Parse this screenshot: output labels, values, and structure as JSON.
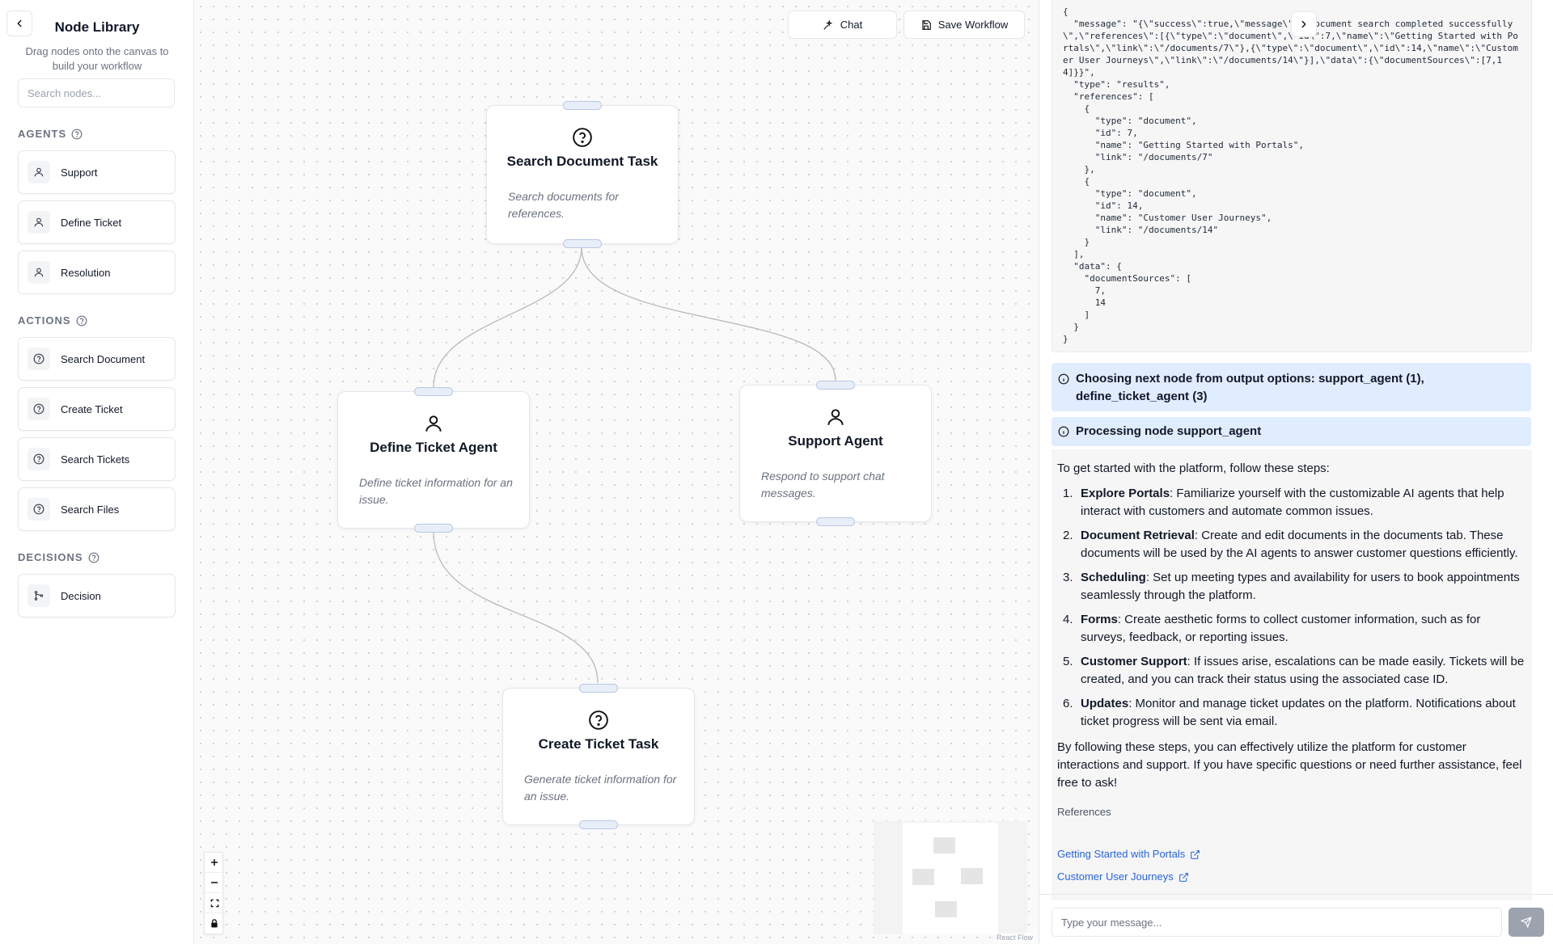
{
  "sidebar": {
    "title": "Node Library",
    "subtitle": "Drag nodes onto the canvas to build your workflow",
    "search_placeholder": "Search nodes...",
    "sections": {
      "agents": {
        "title": "AGENTS",
        "items": [
          "Support",
          "Define Ticket",
          "Resolution"
        ]
      },
      "actions": {
        "title": "ACTIONS",
        "items": [
          "Search Document",
          "Create Ticket",
          "Search Tickets",
          "Search Files"
        ]
      },
      "decisions": {
        "title": "DECISIONS",
        "items": [
          "Decision"
        ]
      }
    }
  },
  "toolbar": {
    "chat_label": "Chat",
    "save_label": "Save Workflow"
  },
  "canvas": {
    "nodes": {
      "search_document": {
        "title": "Search Document Task",
        "description": "Search documents for references."
      },
      "define_ticket": {
        "title": "Define Ticket Agent",
        "description": "Define ticket information for an issue."
      },
      "support": {
        "title": "Support Agent",
        "description": "Respond to support chat messages."
      },
      "create_ticket": {
        "title": "Create Ticket Task",
        "description": "Generate ticket information for an issue."
      }
    },
    "attribution": "React Flow"
  },
  "chat": {
    "code_output": "{\n  \"message\": \"{\\\"success\\\":true,\\\"message\\\":\\\"Document search completed successfully\\\",\\\"references\\\":[{\\\"type\\\":\\\"document\\\",\\\"id\\\":7,\\\"name\\\":\\\"Getting Started with Portals\\\",\\\"link\\\":\\\"/documents/7\\\"},{\\\"type\\\":\\\"document\\\",\\\"id\\\":14,\\\"name\\\":\\\"Customer User Journeys\\\",\\\"link\\\":\\\"/documents/14\\\"}],\\\"data\\\":{\\\"documentSources\\\":[7,14]}}\",\n  \"type\": \"results\",\n  \"references\": [\n    {\n      \"type\": \"document\",\n      \"id\": 7,\n      \"name\": \"Getting Started with Portals\",\n      \"link\": \"/documents/7\"\n    },\n    {\n      \"type\": \"document\",\n      \"id\": 14,\n      \"name\": \"Customer User Journeys\",\n      \"link\": \"/documents/14\"\n    }\n  ],\n  \"data\": {\n    \"documentSources\": [\n      7,\n      14\n    ]\n  }\n}",
    "status_choosing": "Choosing next node from output options: support_agent (1), define_ticket_agent (3)",
    "status_processing": "Processing node support_agent",
    "intro": "To get started with the platform, follow these steps:",
    "steps": [
      {
        "num": "1.",
        "title": "Explore Portals",
        "text": ": Familiarize yourself with the customizable AI agents that help interact with customers and automate common issues."
      },
      {
        "num": "2.",
        "title": "Document Retrieval",
        "text": ": Create and edit documents in the documents tab. These documents will be used by the AI agents to answer customer questions efficiently."
      },
      {
        "num": "3.",
        "title": "Scheduling",
        "text": ": Set up meeting types and availability for users to book appointments seamlessly through the platform."
      },
      {
        "num": "4.",
        "title": "Forms",
        "text": ": Create aesthetic forms to collect customer information, such as for surveys, feedback, or reporting issues."
      },
      {
        "num": "5.",
        "title": "Customer Support",
        "text": ": If issues arise, escalations can be made easily. Tickets will be created, and you can track their status using the associated case ID."
      },
      {
        "num": "6.",
        "title": "Updates",
        "text": ": Monitor and manage ticket updates on the platform. Notifications about ticket progress will be sent via email."
      }
    ],
    "outro": "By following these steps, you can effectively utilize the platform for customer interactions and support. If you have specific questions or need further assistance, feel free to ask!",
    "references_label": "References",
    "references": [
      "Getting Started with Portals",
      "Customer User Journeys"
    ],
    "input_placeholder": "Type your message..."
  },
  "colors": {
    "handle": "#e8eef8",
    "status_bg": "#e0ecff",
    "link": "#2563eb",
    "send_button": "#9ca3af"
  },
  "icons": {
    "agent": "user-icon",
    "action": "help-circle-icon",
    "decision": "branch-icon"
  }
}
